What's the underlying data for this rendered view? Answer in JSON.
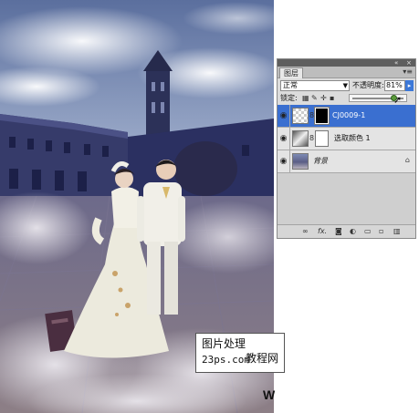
{
  "panel": {
    "tab_label": "图层",
    "collapse_icon": "double-chevron",
    "close_icon": "close",
    "menu_icon": "panel-menu",
    "blend_mode": "正常",
    "opacity_label": "不透明度:",
    "opacity_value": "81%",
    "opacity_fraction": 0.81,
    "lock_label": "锁定:",
    "accent_color": "#3a6fd0"
  },
  "layers": [
    {
      "name": "CJ0009-1",
      "selected": true,
      "visible": true
    },
    {
      "name": "选取颜色 1",
      "selected": false,
      "visible": true
    },
    {
      "name": "背景",
      "selected": false,
      "visible": true,
      "locked": true
    }
  ],
  "bottom_icons": [
    "link-icon",
    "fx-icon",
    "mask-icon",
    "adjustment-icon",
    "group-icon",
    "new-layer-icon",
    "trash-icon"
  ],
  "watermark": {
    "line1": "图片处理",
    "line2": "23ps.com",
    "line2b": "教程网",
    "corner": "W"
  }
}
